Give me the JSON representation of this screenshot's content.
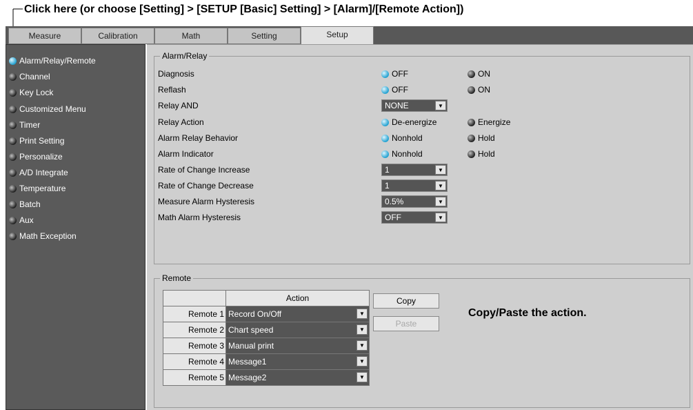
{
  "callout_top": "Click here (or choose [Setting] > [SETUP [Basic] Setting] > [Alarm]/[Remote Action])",
  "callout_right": "Copy/Paste the action.",
  "tabs": [
    "Measure",
    "Calibration",
    "Math",
    "Setting",
    "Setup"
  ],
  "active_tab": "Setup",
  "sidebar": [
    {
      "label": "Alarm/Relay/Remote",
      "selected": true
    },
    {
      "label": "Channel"
    },
    {
      "label": "Key Lock"
    },
    {
      "label": "Customized Menu"
    },
    {
      "label": "Timer"
    },
    {
      "label": "Print Setting"
    },
    {
      "label": "Personalize"
    },
    {
      "label": "A/D Integrate"
    },
    {
      "label": "Temperature"
    },
    {
      "label": "Batch"
    },
    {
      "label": "Aux"
    },
    {
      "label": "Math Exception"
    }
  ],
  "alarm_relay": {
    "title": "Alarm/Relay",
    "diagnosis": {
      "label": "Diagnosis",
      "opt1": "OFF",
      "opt2": "ON"
    },
    "reflash": {
      "label": "Reflash",
      "opt1": "OFF",
      "opt2": "ON"
    },
    "relay_and": {
      "label": "Relay AND",
      "value": "NONE"
    },
    "relay_action": {
      "label": "Relay Action",
      "opt1": "De-energize",
      "opt2": "Energize"
    },
    "alarm_relay_behavior": {
      "label": "Alarm Relay Behavior",
      "opt1": "Nonhold",
      "opt2": "Hold"
    },
    "alarm_indicator": {
      "label": "Alarm Indicator",
      "opt1": "Nonhold",
      "opt2": "Hold"
    },
    "rate_increase": {
      "label": "Rate of Change Increase",
      "value": "1"
    },
    "rate_decrease": {
      "label": "Rate of Change Decrease",
      "value": "1"
    },
    "measure_hysteresis": {
      "label": "Measure Alarm Hysteresis",
      "value": "0.5%"
    },
    "math_hysteresis": {
      "label": "Math Alarm Hysteresis",
      "value": "OFF"
    }
  },
  "remote": {
    "title": "Remote",
    "action_header": "Action",
    "copy_label": "Copy",
    "paste_label": "Paste",
    "rows": [
      {
        "name": "Remote 1",
        "action": "Record On/Off"
      },
      {
        "name": "Remote 2",
        "action": "Chart speed"
      },
      {
        "name": "Remote 3",
        "action": "Manual print"
      },
      {
        "name": "Remote 4",
        "action": "Message1"
      },
      {
        "name": "Remote 5",
        "action": "Message2"
      }
    ]
  }
}
